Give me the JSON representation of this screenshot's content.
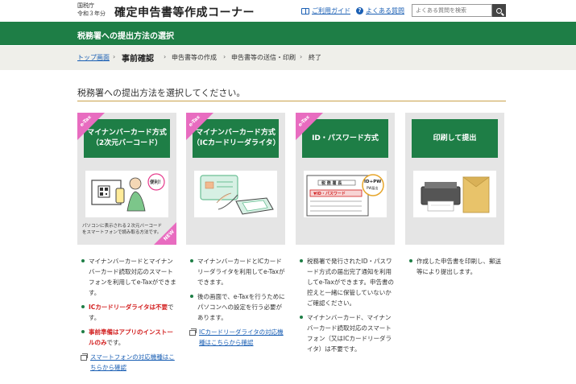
{
  "header": {
    "agency_line1": "国税庁",
    "agency_line2": "令和３年分",
    "app_title": "確定申告書等作成コーナー",
    "guide_link": "ご利用ガイド",
    "faq_link": "よくある質問",
    "search_placeholder": "よくある質問を検索"
  },
  "page_title": "税務署への提出方法の選択",
  "breadcrumb": {
    "top": "トップ画面",
    "current": "事前確認",
    "step2": "申告書等の作成",
    "step3": "申告書等の送信・印刷",
    "step4": "終了",
    "separator": "›"
  },
  "instruction": "税務署への提出方法を選択してください。",
  "cards": [
    {
      "tag": "e-Tax",
      "title_line1": "マイナンバーカード方式",
      "title_line2": "（2次元バーコード）",
      "note_line1": "パソコンに表示される２次元バーコード",
      "note_line2": "をスマートフォンで読み取る方法です。",
      "new_tag": "NEW",
      "bubble": "便利！",
      "desc": [
        {
          "text": "マイナンバーカードとマイナンバーカード読取対応のスマートフォンを利用してe-Taxができます。"
        },
        {
          "red": "ICカードリーダライタは不要",
          "rest": "です。"
        },
        {
          "red": "事前準備はアプリのインストールのみ",
          "rest": "です。"
        }
      ],
      "link": "スマートフォンの対応機種はこちらから確認"
    },
    {
      "tag": "e-Tax",
      "title_line1": "マイナンバーカード方式",
      "title_line2": "（ICカードリーダライタ）",
      "desc": [
        {
          "text": "マイナンバーカードとICカードリーダライタを利用してe-Taxができます。"
        },
        {
          "text": "後の画面で、e-Taxを行うためにパソコンへの設定を行う必要があります。"
        }
      ],
      "link": "ICカードリーダライタの対応機種はこちらから確認"
    },
    {
      "tag": "e-Tax",
      "title_line1": "ID・パスワード方式",
      "doc_header": "税 務 署 長",
      "doc_strip": "▼ID・パスワード",
      "badge_line1": "ID+PW",
      "badge_line2": "PW届出",
      "desc": [
        {
          "text": "税務署で発行されたID・パスワード方式の届出完了通知を利用してe-Taxができます。申告書の控えと一緒に保管していないかご確認ください。"
        },
        {
          "text": "マイナンバーカード、マイナンバーカード読取対応のスマートフォン（又はICカードリーダライタ）は不要です。"
        }
      ]
    },
    {
      "title_line1": "印刷して提出",
      "desc": [
        {
          "text": "作成した申告書を印刷し、郵送等により提出します。"
        }
      ]
    }
  ],
  "colors": {
    "brand_green": "#1e7e46",
    "etax_pink": "#e86cc0",
    "link_blue": "#1a5fb4",
    "alert_red": "#d21e1e",
    "gold_rule": "#c9a24a"
  }
}
